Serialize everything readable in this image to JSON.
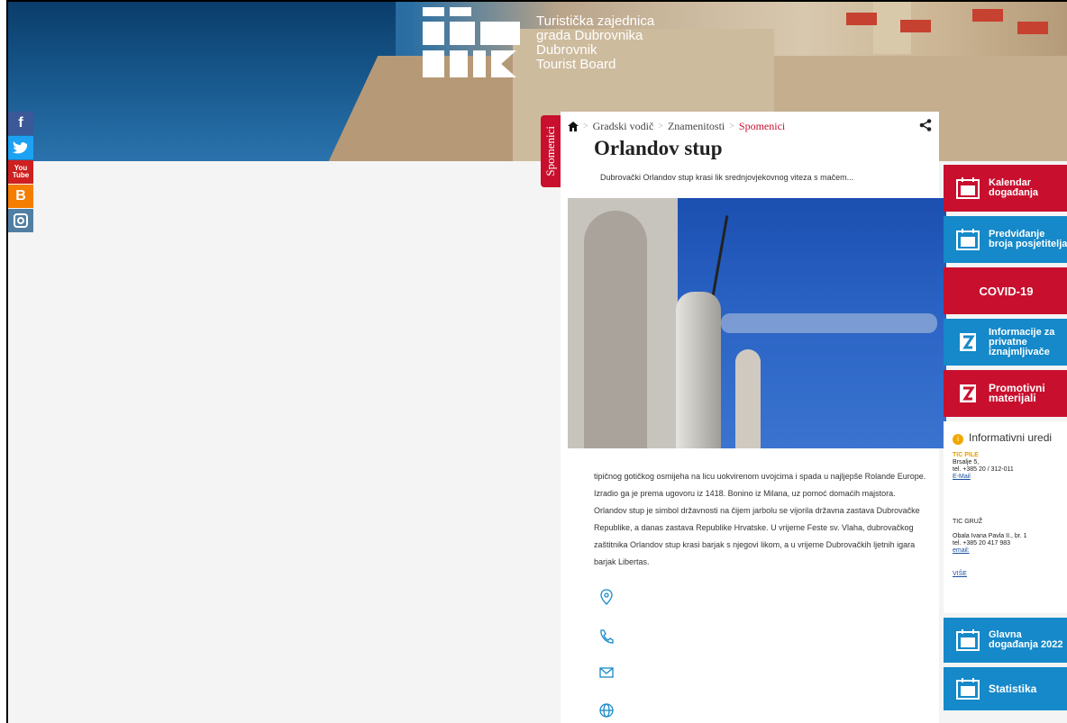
{
  "caption": "Dubrovnik Tourist Board – Orlandov stup page (screenshot)",
  "brand": {
    "line1": "Turistička zajednica",
    "line2": "grada Dubrovnika",
    "line3": "Dubrovnik",
    "line4": "Tourist Board"
  },
  "social": [
    "facebook",
    "twitter",
    "youtube",
    "blogger",
    "instagram"
  ],
  "breadcrumb": {
    "home_icon": "home-icon",
    "items": [
      "Gradski vodič",
      "Znamenitosti",
      "Spomenici"
    ]
  },
  "side_tab": "Spomenici",
  "article": {
    "title": "Orlandov stup",
    "lead": "Dubrovački Orlandov stup krasi lik srednjovjekovnog viteza s mačem...",
    "body": "tipičnog gotičkog osmijeha na licu uokvirenom uvojcima i spada u najljepše Rolande Europe. Izradio ga je prema ugovoru iz 1418. Bonino iz Milana, uz pomoć domaćih majstora. Orlandov stup je simbol državnosti na čijem jarbolu se vijorila državna zastava Dubrovačke Republike, a danas zastava Republike Hrvatske. U vrijeme Feste sv. Vlaha, dubrovačkog zaštitnika Orlandov stup krasi barjak s njegovi likom, a u vrijeme Dubrovačkih ljetnih igara barjak Libertas.",
    "contacts": [
      "location-icon",
      "phone-icon",
      "mail-icon",
      "globe-icon"
    ]
  },
  "rail": {
    "tiles": [
      {
        "label": "Kalendar događanja",
        "color": "#c8102e",
        "icon": "calendar-icon"
      },
      {
        "label": "Predviđanje broja posjetitelja",
        "color": "#1589c9",
        "icon": "calendar-icon"
      },
      {
        "label": "COVID-19",
        "color": "#c8102e",
        "icon": ""
      },
      {
        "label": "Informacije za privatne iznajmljivače",
        "color": "#1589c9",
        "icon": "tz-logo-icon"
      },
      {
        "label": "Promotivni materijali",
        "color": "#c8102e",
        "icon": "tz-logo-icon"
      }
    ],
    "info": {
      "title": "Informativni uredi",
      "tic_pile": {
        "name": "TIC PILE",
        "address": "Brsalje 5,",
        "tel": "tel. +385 20 / 312-011",
        "email": "E-Mail"
      },
      "tic_gruz": {
        "name": "TIC GRUŽ",
        "address": "Obala Ivana Pavla II., br. 1",
        "tel": "tel. +385 20 417 983",
        "email": "email:"
      },
      "more": "VIŠE"
    },
    "tiles_bottom": [
      {
        "label": "Glavna događanja 2022",
        "color": "#1589c9",
        "icon": "calendar-icon"
      },
      {
        "label": "Statistika",
        "color": "#1589c9",
        "icon": "calendar-icon"
      }
    ]
  }
}
